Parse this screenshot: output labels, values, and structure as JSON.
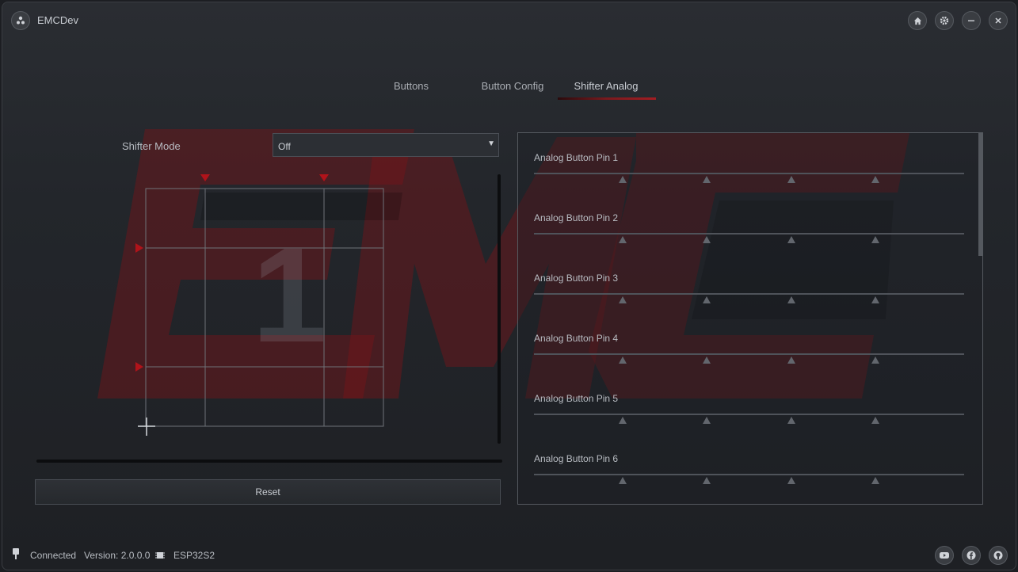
{
  "app": {
    "title": "EMCDev"
  },
  "window_controls": [
    "home-icon",
    "gear-icon",
    "minimize-icon",
    "close-icon"
  ],
  "tabs": [
    {
      "label": "Buttons",
      "active": false
    },
    {
      "label": "Button Config",
      "active": false
    },
    {
      "label": "Shifter Analog",
      "active": true
    }
  ],
  "shifter": {
    "mode_label": "Shifter Mode",
    "mode_value": "Off",
    "gear_display": "1",
    "reset_label": "Reset"
  },
  "analog_pins": [
    {
      "label": "Analog Button Pin 1"
    },
    {
      "label": "Analog Button Pin 2"
    },
    {
      "label": "Analog Button Pin 3"
    },
    {
      "label": "Analog Button Pin 4"
    },
    {
      "label": "Analog Button Pin 5"
    },
    {
      "label": "Analog Button Pin 6"
    }
  ],
  "status": {
    "connection": "Connected",
    "version": "Version: 2.0.0.0",
    "chip": "ESP32S2"
  },
  "social": [
    "youtube-icon",
    "facebook-icon",
    "github-icon"
  ],
  "colors": {
    "accent": "#a31d22",
    "marker": "#b0131a"
  }
}
